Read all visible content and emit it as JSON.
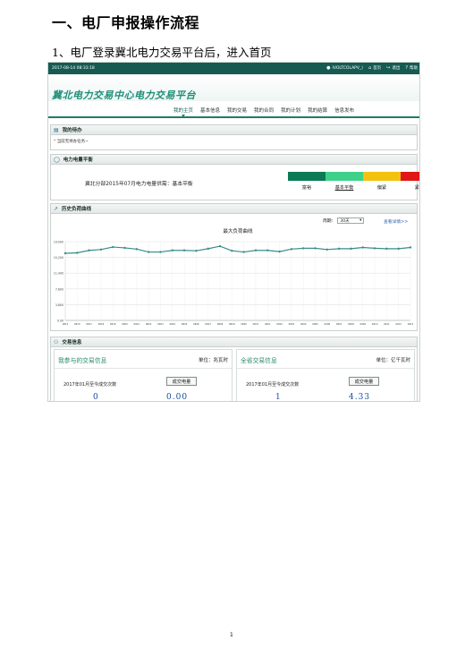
{
  "document": {
    "heading": "一、电厂申报操作流程",
    "step": "1、电厂登录冀北电力交易平台后，进入首页",
    "page_number": "1"
  },
  "screenshot": {
    "topbar": {
      "time": "2017-08-14 08:33:18",
      "user": "IVOLTCOLAPV_)",
      "home": "首页",
      "logout": "退出",
      "help": "帮助"
    },
    "brand": {
      "logo": "冀北电力交易中心电力交易平台"
    },
    "nav": {
      "items": [
        "我的主页",
        "基本信息",
        "我的交易",
        "我的合同",
        "我的计划",
        "我的结算",
        "信息发布"
      ],
      "active_index": 0
    },
    "todo": {
      "title": "我的待办",
      "empty_text": "当前无待办任务~"
    },
    "balance": {
      "title": "电力电量平衡",
      "text": "冀北分部2015年07月电力电量供需：基本平衡",
      "levels": [
        {
          "label": "富裕",
          "color": "#0c7a55"
        },
        {
          "label": "基本平衡",
          "color": "#3fd089"
        },
        {
          "label": "偏紧",
          "color": "#f2c20f"
        },
        {
          "label": "紧张",
          "color": "#df1717"
        }
      ],
      "selected_index": 1
    },
    "history": {
      "title": "历史负荷曲线",
      "period_label": "周期：",
      "period_value": "30天",
      "detail_link": "查看详情>>"
    },
    "trade": {
      "title": "交易信息",
      "left": {
        "title": "我参与的交易信息",
        "unit": "单位：兆瓦时",
        "label": "2017年01月至今成交次数",
        "button": "成交电量",
        "count": "0",
        "volume": "0.00"
      },
      "right": {
        "title": "全省交易信息",
        "unit": "单位：亿千瓦时",
        "label": "2017年01月至今成交次数",
        "button": "成交电量",
        "count": "1",
        "volume": "4.33"
      }
    }
  },
  "chart_data": {
    "type": "line",
    "title": "最大负荷曲线",
    "y_ticks": [
      "0.00",
      "3,800",
      "7,600",
      "11,400",
      "15,200",
      "19,000"
    ],
    "ylim": [
      0,
      19000
    ],
    "x": [
      "0813",
      "0815",
      "0817",
      "0818",
      "0819",
      "0820",
      "0821",
      "0822",
      "0823",
      "0824",
      "0825",
      "0826",
      "0827",
      "0828",
      "0829",
      "0830",
      "0831",
      "0901",
      "0902",
      "0903",
      "0904",
      "0905",
      "0906",
      "0907",
      "0908",
      "0909",
      "0910",
      "0911",
      "0912",
      "0913"
    ],
    "series": [
      {
        "values": [
          16200,
          16300,
          16900,
          17100,
          17700,
          17500,
          17200,
          16500,
          16500,
          16900,
          16900,
          16800,
          17300,
          17900,
          16800,
          16500,
          16900,
          16900,
          16600,
          17200,
          17400,
          17400,
          17100,
          17300,
          17300,
          17600,
          17400,
          17300,
          17300,
          17600
        ],
        "color": "#3a8c8a"
      }
    ],
    "grid": true
  }
}
